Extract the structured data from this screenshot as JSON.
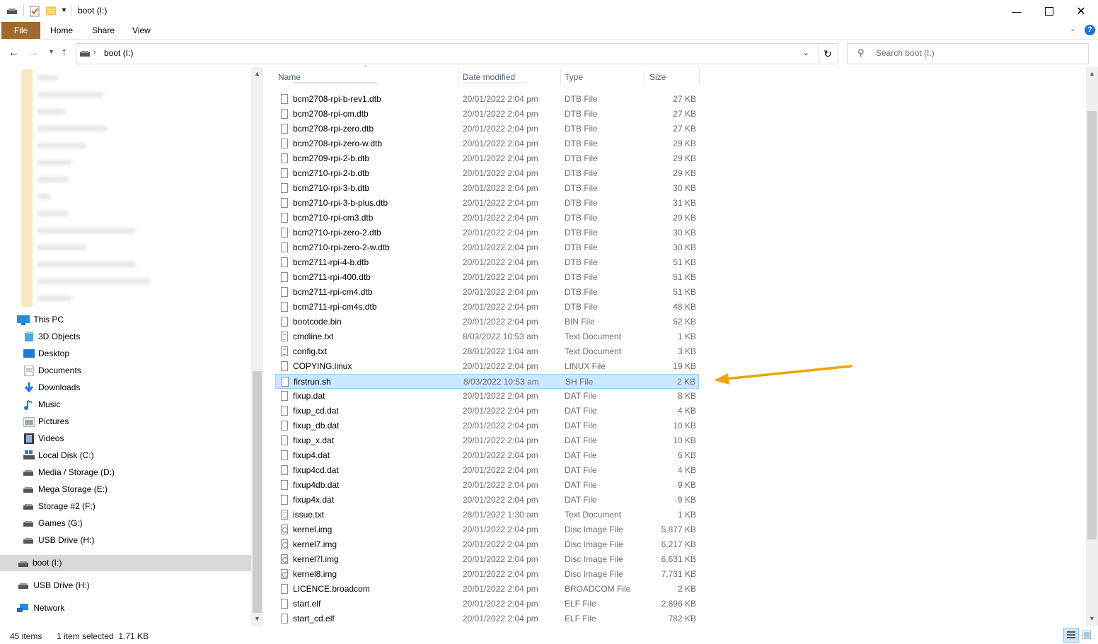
{
  "window": {
    "title": "boot (I:)"
  },
  "ribbon": {
    "tabs": [
      "File",
      "Home",
      "Share",
      "View"
    ]
  },
  "address": {
    "path_root_icon": "drive-icon",
    "crumb": "boot (I:)",
    "search_placeholder": "Search boot (I:)"
  },
  "nav": {
    "this_pc": "This PC",
    "items": [
      {
        "label": "3D Objects",
        "icon": "3d-objects-icon"
      },
      {
        "label": "Desktop",
        "icon": "desktop-icon"
      },
      {
        "label": "Documents",
        "icon": "documents-icon"
      },
      {
        "label": "Downloads",
        "icon": "downloads-icon"
      },
      {
        "label": "Music",
        "icon": "music-icon"
      },
      {
        "label": "Pictures",
        "icon": "pictures-icon"
      },
      {
        "label": "Videos",
        "icon": "videos-icon"
      },
      {
        "label": "Local Disk (C:)",
        "icon": "local-disk-icon"
      },
      {
        "label": "Media / Storage (D:)",
        "icon": "drive-icon"
      },
      {
        "label": "Mega Storage (E:)",
        "icon": "drive-icon"
      },
      {
        "label": "Storage #2 (F:)",
        "icon": "drive-icon"
      },
      {
        "label": "Games (G:)",
        "icon": "drive-icon"
      },
      {
        "label": "USB Drive (H:)",
        "icon": "drive-icon"
      }
    ],
    "boot": "boot (I:)",
    "usb": "USB Drive (H:)",
    "network": "Network"
  },
  "columns": {
    "name": "Name",
    "date": "Date modified",
    "type": "Type",
    "size": "Size"
  },
  "files": [
    {
      "name": "bcm2708-rpi-b-rev1.dtb",
      "date": "20/01/2022 2:04 pm",
      "type": "DTB File",
      "size": "27 KB",
      "icon": "file"
    },
    {
      "name": "bcm2708-rpi-cm.dtb",
      "date": "20/01/2022 2:04 pm",
      "type": "DTB File",
      "size": "27 KB",
      "icon": "file"
    },
    {
      "name": "bcm2708-rpi-zero.dtb",
      "date": "20/01/2022 2:04 pm",
      "type": "DTB File",
      "size": "27 KB",
      "icon": "file"
    },
    {
      "name": "bcm2708-rpi-zero-w.dtb",
      "date": "20/01/2022 2:04 pm",
      "type": "DTB File",
      "size": "29 KB",
      "icon": "file"
    },
    {
      "name": "bcm2709-rpi-2-b.dtb",
      "date": "20/01/2022 2:04 pm",
      "type": "DTB File",
      "size": "29 KB",
      "icon": "file"
    },
    {
      "name": "bcm2710-rpi-2-b.dtb",
      "date": "20/01/2022 2:04 pm",
      "type": "DTB File",
      "size": "29 KB",
      "icon": "file"
    },
    {
      "name": "bcm2710-rpi-3-b.dtb",
      "date": "20/01/2022 2:04 pm",
      "type": "DTB File",
      "size": "30 KB",
      "icon": "file"
    },
    {
      "name": "bcm2710-rpi-3-b-plus.dtb",
      "date": "20/01/2022 2:04 pm",
      "type": "DTB File",
      "size": "31 KB",
      "icon": "file"
    },
    {
      "name": "bcm2710-rpi-cm3.dtb",
      "date": "20/01/2022 2:04 pm",
      "type": "DTB File",
      "size": "29 KB",
      "icon": "file"
    },
    {
      "name": "bcm2710-rpi-zero-2.dtb",
      "date": "20/01/2022 2:04 pm",
      "type": "DTB File",
      "size": "30 KB",
      "icon": "file"
    },
    {
      "name": "bcm2710-rpi-zero-2-w.dtb",
      "date": "20/01/2022 2:04 pm",
      "type": "DTB File",
      "size": "30 KB",
      "icon": "file"
    },
    {
      "name": "bcm2711-rpi-4-b.dtb",
      "date": "20/01/2022 2:04 pm",
      "type": "DTB File",
      "size": "51 KB",
      "icon": "file"
    },
    {
      "name": "bcm2711-rpi-400.dtb",
      "date": "20/01/2022 2:04 pm",
      "type": "DTB File",
      "size": "51 KB",
      "icon": "file"
    },
    {
      "name": "bcm2711-rpi-cm4.dtb",
      "date": "20/01/2022 2:04 pm",
      "type": "DTB File",
      "size": "51 KB",
      "icon": "file"
    },
    {
      "name": "bcm2711-rpi-cm4s.dtb",
      "date": "20/01/2022 2:04 pm",
      "type": "DTB File",
      "size": "48 KB",
      "icon": "file"
    },
    {
      "name": "bootcode.bin",
      "date": "20/01/2022 2:04 pm",
      "type": "BIN File",
      "size": "52 KB",
      "icon": "file"
    },
    {
      "name": "cmdline.txt",
      "date": "8/03/2022 10:53 am",
      "type": "Text Document",
      "size": "1 KB",
      "icon": "txt"
    },
    {
      "name": "config.txt",
      "date": "28/01/2022 1:04 am",
      "type": "Text Document",
      "size": "3 KB",
      "icon": "txt"
    },
    {
      "name": "COPYING.linux",
      "date": "20/01/2022 2:04 pm",
      "type": "LINUX File",
      "size": "19 KB",
      "icon": "file"
    },
    {
      "name": "firstrun.sh",
      "date": "8/03/2022 10:53 am",
      "type": "SH File",
      "size": "2 KB",
      "icon": "file",
      "selected": true
    },
    {
      "name": "fixup.dat",
      "date": "20/01/2022 2:04 pm",
      "type": "DAT File",
      "size": "8 KB",
      "icon": "file"
    },
    {
      "name": "fixup_cd.dat",
      "date": "20/01/2022 2:04 pm",
      "type": "DAT File",
      "size": "4 KB",
      "icon": "file"
    },
    {
      "name": "fixup_db.dat",
      "date": "20/01/2022 2:04 pm",
      "type": "DAT File",
      "size": "10 KB",
      "icon": "file"
    },
    {
      "name": "fixup_x.dat",
      "date": "20/01/2022 2:04 pm",
      "type": "DAT File",
      "size": "10 KB",
      "icon": "file"
    },
    {
      "name": "fixup4.dat",
      "date": "20/01/2022 2:04 pm",
      "type": "DAT File",
      "size": "6 KB",
      "icon": "file"
    },
    {
      "name": "fixup4cd.dat",
      "date": "20/01/2022 2:04 pm",
      "type": "DAT File",
      "size": "4 KB",
      "icon": "file"
    },
    {
      "name": "fixup4db.dat",
      "date": "20/01/2022 2:04 pm",
      "type": "DAT File",
      "size": "9 KB",
      "icon": "file"
    },
    {
      "name": "fixup4x.dat",
      "date": "20/01/2022 2:04 pm",
      "type": "DAT File",
      "size": "9 KB",
      "icon": "file"
    },
    {
      "name": "issue.txt",
      "date": "28/01/2022 1:30 am",
      "type": "Text Document",
      "size": "1 KB",
      "icon": "txt"
    },
    {
      "name": "kernel.img",
      "date": "20/01/2022 2:04 pm",
      "type": "Disc Image File",
      "size": "5,877 KB",
      "icon": "img"
    },
    {
      "name": "kernel7.img",
      "date": "20/01/2022 2:04 pm",
      "type": "Disc Image File",
      "size": "6,217 KB",
      "icon": "img"
    },
    {
      "name": "kernel7l.img",
      "date": "20/01/2022 2:04 pm",
      "type": "Disc Image File",
      "size": "6,631 KB",
      "icon": "img"
    },
    {
      "name": "kernel8.img",
      "date": "20/01/2022 2:04 pm",
      "type": "Disc Image File",
      "size": "7,731 KB",
      "icon": "img"
    },
    {
      "name": "LICENCE.broadcom",
      "date": "20/01/2022 2:04 pm",
      "type": "BROADCOM File",
      "size": "2 KB",
      "icon": "file"
    },
    {
      "name": "start.elf",
      "date": "20/01/2022 2:04 pm",
      "type": "ELF File",
      "size": "2,896 KB",
      "icon": "file"
    },
    {
      "name": "start_cd.elf",
      "date": "20/01/2022 2:04 pm",
      "type": "ELF File",
      "size": "782 KB",
      "icon": "file"
    }
  ],
  "status": {
    "count": "45 items",
    "selection": "1 item selected  1.71 KB"
  },
  "colors": {
    "file_tab": "#a16a2b",
    "selection": "#cce8ff",
    "annotation_arrow": "#f0a30a"
  }
}
